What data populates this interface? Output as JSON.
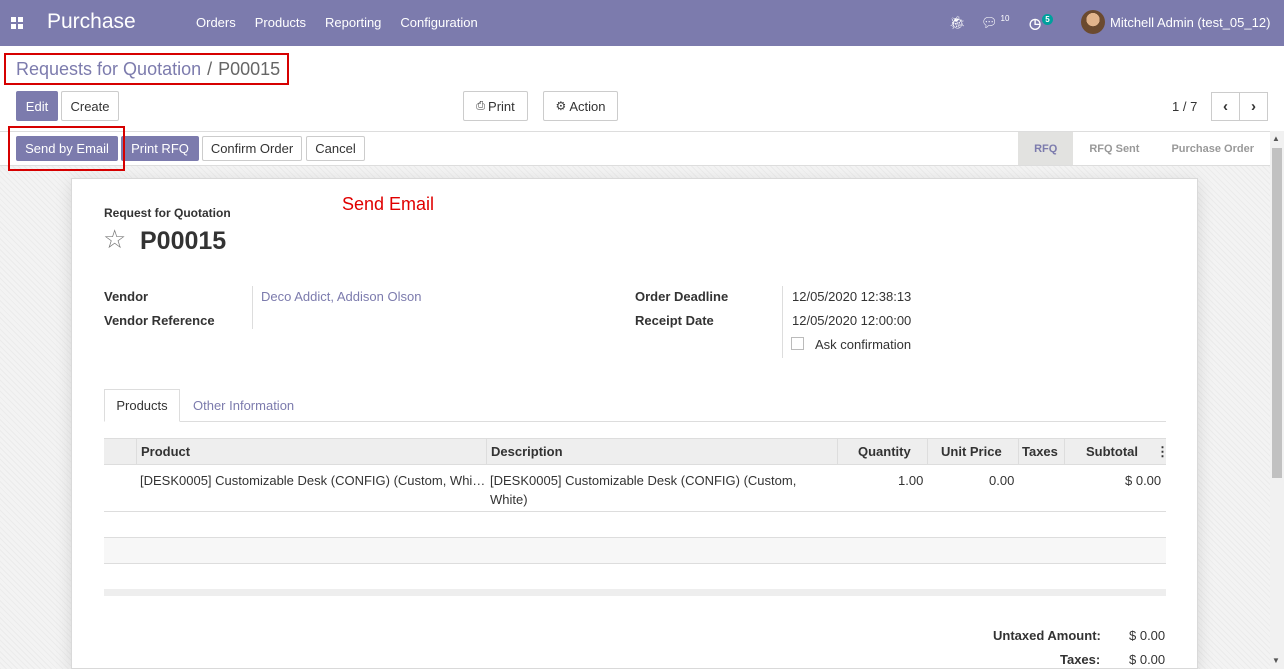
{
  "navbar": {
    "app_name": "Purchase",
    "menu": [
      "Orders",
      "Products",
      "Reporting",
      "Configuration"
    ],
    "chat_count": "10",
    "activity_count": "5",
    "user": "Mitchell Admin (test_05_12)"
  },
  "breadcrumb": {
    "parent": "Requests for Quotation",
    "separator": "/",
    "current": "P00015"
  },
  "toolbar": {
    "edit": "Edit",
    "create": "Create",
    "print": "Print",
    "action": "Action",
    "pager": "1 / 7"
  },
  "statusbar": {
    "buttons": [
      "Send by Email",
      "Print RFQ",
      "Confirm Order",
      "Cancel"
    ],
    "stages": [
      "RFQ",
      "RFQ Sent",
      "Purchase Order"
    ],
    "active_stage": "RFQ"
  },
  "annotation": "Send Email",
  "form": {
    "doc_type": "Request for Quotation",
    "name": "P00015",
    "vendor_label": "Vendor",
    "vendor_value": "Deco Addict, Addison Olson",
    "vendor_ref_label": "Vendor Reference",
    "order_deadline_label": "Order Deadline",
    "order_deadline_value": "12/05/2020 12:38:13",
    "receipt_date_label": "Receipt Date",
    "receipt_date_value": "12/05/2020 12:00:00",
    "ask_confirmation_label": "Ask confirmation",
    "ask_confirmation_checked": false
  },
  "tabs": [
    "Products",
    "Other Information"
  ],
  "lines": {
    "columns": [
      "Product",
      "Description",
      "Quantity",
      "Unit Price",
      "Taxes",
      "Subtotal"
    ],
    "rows": [
      {
        "product": "[DESK0005] Customizable Desk (CONFIG) (Custom, Whi…",
        "description_line1": "[DESK0005] Customizable Desk (CONFIG) (Custom,",
        "description_line2": "White)",
        "quantity": "1.00",
        "unit_price": "0.00",
        "taxes": "",
        "subtotal": "$ 0.00"
      }
    ]
  },
  "totals": {
    "untaxed_label": "Untaxed Amount:",
    "untaxed_value": "$ 0.00",
    "taxes_label": "Taxes:",
    "taxes_value": "$ 0.00"
  },
  "colors": {
    "brand": "#7c7bad",
    "annotation_red": "#e00000"
  }
}
